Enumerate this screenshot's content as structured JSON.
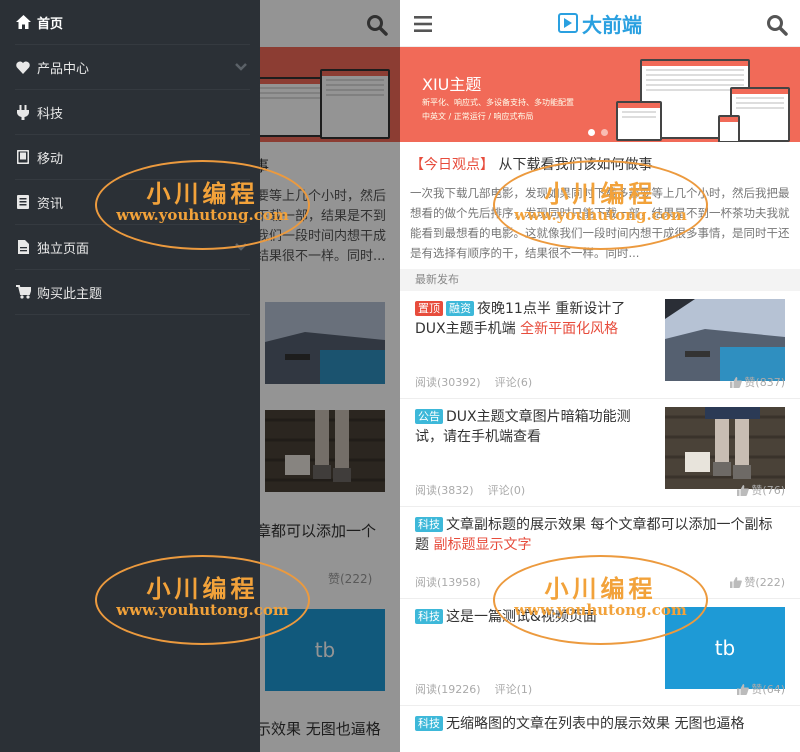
{
  "drawer": {
    "items": [
      {
        "label": "首页",
        "icon": "home-icon",
        "active": true
      },
      {
        "label": "产品中心",
        "icon": "heart-icon",
        "has_submenu": true
      },
      {
        "label": "科技",
        "icon": "plug-icon"
      },
      {
        "label": "移动",
        "icon": "tablet-icon"
      },
      {
        "label": "资讯",
        "icon": "book-icon"
      },
      {
        "label": "独立页面",
        "icon": "file-icon",
        "has_submenu": true
      },
      {
        "label": "购买此主题",
        "icon": "cart-icon"
      }
    ]
  },
  "middle": {
    "fragments": {
      "t1": "事",
      "p1": "要等上几个小时，然后",
      "p2": "下载一部，结果是不到",
      "p3": "我们一段时间内想干成",
      "p4": "结果很不一样。同时...",
      "t2": "章都可以添加一个",
      "like": "赞(222)",
      "t3": "示效果 无图也逼格"
    }
  },
  "header": {
    "logo_text": "大前端"
  },
  "banner": {
    "title": "XIU主题",
    "sub1": "新平化、响应式、多设备支持、多功能配置",
    "sub2": "中英文 / 正常运行 / 响应式布局"
  },
  "today": {
    "tag": "【今日观点】",
    "title": "从下载看我们该如何做事",
    "excerpt": "一次我下载几部电影，发现如果同时下载多部要等上几个小时，然后我把最想看的做个先后排序，发现同时只能下载一部，结果是不到一杯茶功夫我就能看到最想看的电影。这就像我们一段时间内想干成很多事情，是同时干还是有选择有顺序的干，结果很不一样。同时..."
  },
  "section": {
    "title": "最新发布"
  },
  "posts": [
    {
      "badges": [
        "置顶",
        "融资"
      ],
      "title": "夜晚11点半 重新设计了DUX主题手机端",
      "subtitle": "全新平面化风格",
      "read": "阅读(30392)",
      "comment": "评论(6)",
      "like": "赞(837)",
      "thumb": "pool"
    },
    {
      "badges": [
        "公告"
      ],
      "title": "DUX主题文章图片暗箱功能测试，请在手机端查看",
      "subtitle": "",
      "read": "阅读(3832)",
      "comment": "评论(0)",
      "like": "赞(76)",
      "thumb": "legs"
    },
    {
      "badges": [
        "科技"
      ],
      "title": "文章副标题的展示效果 每个文章都可以添加一个副标题",
      "subtitle": "副标题显示文字",
      "read": "阅读(13958)",
      "comment": "",
      "like": "赞(222)",
      "thumb": ""
    },
    {
      "badges": [
        "科技"
      ],
      "title": "这是一篇测试&视频页面",
      "subtitle": "",
      "read": "阅读(19226)",
      "comment": "评论(1)",
      "like": "赞(64)",
      "thumb": "tb"
    },
    {
      "badges": [
        "科技"
      ],
      "title": "无缩略图的文章在列表中的展示效果 无图也逼格",
      "subtitle": "",
      "read": "",
      "comment": "",
      "like": "",
      "thumb": ""
    }
  ],
  "thumb_text": "tb",
  "watermark": {
    "line1": "小川编程",
    "line2": "www.youhutong.com"
  },
  "colors": {
    "drawer_bg": "#2b3036",
    "accent_red": "#e74c3c",
    "accent_blue": "#2aa0e0",
    "banner_bg": "#f16a58",
    "watermark": "#f2a23a"
  }
}
